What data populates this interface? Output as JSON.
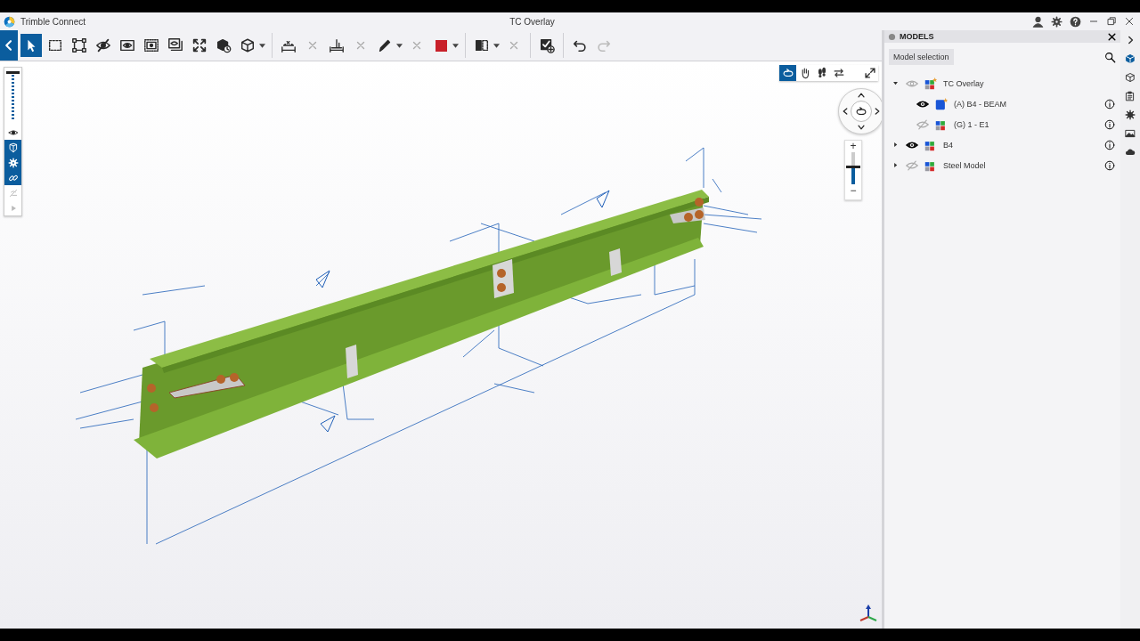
{
  "window": {
    "title": "Trimble Connect",
    "document_title": "TC Overlay"
  },
  "toolbar": {
    "groups": [
      [
        {
          "kind": "tool",
          "selected": true
        },
        {
          "kind": "tool",
          "selected": true
        },
        {
          "kind": "tool",
          "selected": false
        },
        {
          "kind": "tool",
          "selected": false
        },
        {
          "kind": "tool",
          "selected": false
        },
        {
          "kind": "tool",
          "selected": false
        },
        {
          "kind": "tool",
          "selected": false
        },
        {
          "kind": "tool",
          "selected": false
        },
        {
          "kind": "tool",
          "selected": false
        },
        {
          "kind": "tool",
          "selected": false
        },
        {
          "kind": "tool",
          "selected": false
        },
        {
          "kind": "dropdown"
        }
      ],
      [
        {
          "kind": "tool",
          "selected": false
        },
        {
          "kind": "clear"
        },
        {
          "kind": "tool",
          "selected": false
        },
        {
          "kind": "clear"
        },
        {
          "kind": "tool",
          "selected": false
        },
        {
          "kind": "dropdown"
        },
        {
          "kind": "clear"
        },
        {
          "kind": "color",
          "color": "#c8202a"
        },
        {
          "kind": "dropdown"
        }
      ],
      [
        {
          "kind": "tool",
          "selected": false
        },
        {
          "kind": "dropdown"
        },
        {
          "kind": "clear"
        }
      ],
      [
        {
          "kind": "tool"
        }
      ],
      [
        {
          "kind": "tool",
          "disabled": false
        },
        {
          "kind": "tool",
          "disabled": true
        }
      ]
    ]
  },
  "left_panel": {
    "slider": {
      "level": 1
    },
    "tools": [
      {
        "selected": false,
        "disabled": false
      },
      {
        "selected": true,
        "disabled": false
      },
      {
        "selected": true,
        "disabled": false
      },
      {
        "selected": true,
        "disabled": false
      },
      {
        "selected": false,
        "disabled": true
      },
      {
        "selected": false,
        "disabled": true
      }
    ]
  },
  "navigation": {
    "modes": [
      {
        "selected": true
      },
      {
        "selected": false
      },
      {
        "selected": false
      },
      {
        "selected": false
      },
      {
        "selected": false
      }
    ],
    "zoom": {
      "plus": "+",
      "minus": "−",
      "level": 0.55
    }
  },
  "models_panel": {
    "title": "MODELS",
    "selection_button": "Model selection",
    "tree": [
      {
        "name": "TC Overlay",
        "kind": "composite",
        "starred": true,
        "visible": true,
        "partial": true,
        "expanded": true,
        "info": false,
        "children": [
          {
            "name": "(A) B4 - BEAM",
            "kind": "single",
            "starred": true,
            "visible": true,
            "partial": false,
            "info": true
          },
          {
            "name": "(G) 1 - E1",
            "kind": "composite",
            "starred": false,
            "visible": false,
            "partial": false,
            "info": true
          }
        ]
      },
      {
        "name": "B4",
        "kind": "composite",
        "starred": false,
        "visible": true,
        "partial": false,
        "expanded": false,
        "info": true
      },
      {
        "name": "Steel Model",
        "kind": "composite",
        "starred": false,
        "visible": false,
        "partial": false,
        "expanded": false,
        "info": true
      }
    ]
  },
  "side_strip": [
    {
      "selected": false
    },
    {
      "selected": true
    },
    {
      "selected": false
    },
    {
      "selected": false
    },
    {
      "selected": false
    },
    {
      "selected": false
    },
    {
      "selected": false
    }
  ]
}
